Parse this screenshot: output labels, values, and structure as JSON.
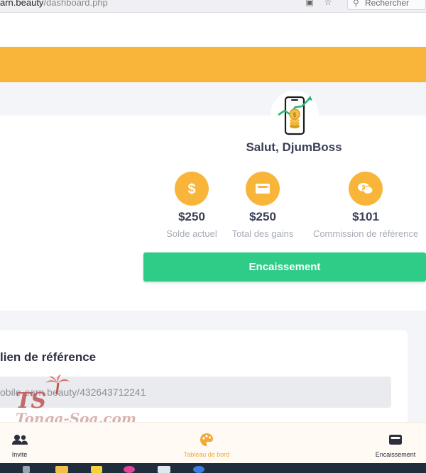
{
  "browser": {
    "url_host": "arn.beauty",
    "url_path": "/dashboard.php",
    "search_placeholder": "Rechercher"
  },
  "profile": {
    "greeting": "Salut, DjumBoss"
  },
  "stats": [
    {
      "icon": "dollar-icon",
      "amount": "$250",
      "label": "Solde actuel"
    },
    {
      "icon": "wallet-icon",
      "amount": "$250",
      "label": "Total des gains"
    },
    {
      "icon": "chat-bubbles-icon",
      "amount": "$101",
      "label": "Commission de référence"
    }
  ],
  "cashout_label": "Encaissement",
  "referral": {
    "title": "lien de référence",
    "link": "obile-earn.beauty/432643712241"
  },
  "watermark": {
    "text": "Tonga-Soa.com",
    "logo_letters": "TS"
  },
  "nav": [
    {
      "icon": "users-icon",
      "label": "Invite",
      "active": false
    },
    {
      "icon": "palette-icon",
      "label": "Tableau de bord",
      "active": true
    },
    {
      "icon": "wallet-icon",
      "label": "Encaissement",
      "active": false
    }
  ],
  "colors": {
    "accent": "#f8b53a",
    "success": "#2ecc87",
    "text_dark": "#3a3f57",
    "muted": "#a8acb8"
  }
}
